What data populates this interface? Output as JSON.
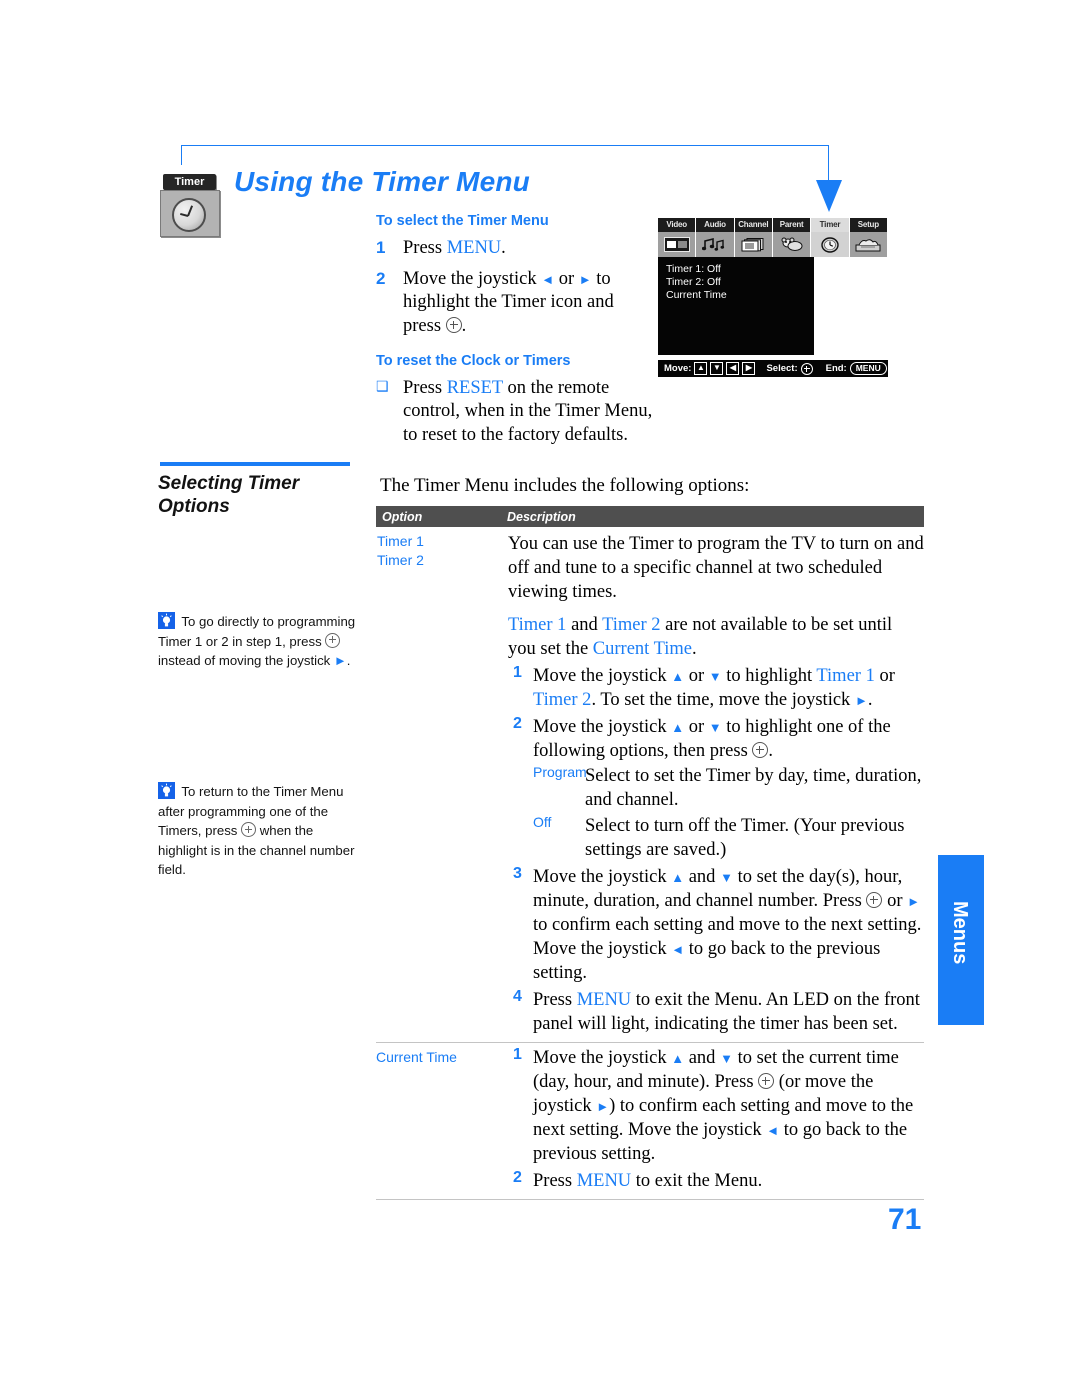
{
  "page": {
    "number": "71",
    "side_tab": "Menus"
  },
  "header": {
    "icon_label": "Timer",
    "icon_name": "clock-icon",
    "title": "Using the Timer Menu",
    "accent_color": "#1a7df5"
  },
  "instructions": {
    "select_heading": "To select the Timer Menu",
    "steps": [
      {
        "num": "1",
        "text_pre": "Press ",
        "keyword": "MENU",
        "text_post": "."
      },
      {
        "num": "2",
        "text": "Move the joystick ← or → to highlight the Timer icon and press ⊕."
      }
    ],
    "reset_heading": "To reset the Clock or Timers",
    "reset_bullet": "❑",
    "reset_text_pre": "Press ",
    "reset_keyword": "RESET",
    "reset_text_post": " on the remote control, when in the Timer Menu, to reset to the factory defaults."
  },
  "tv_menu": {
    "tabs": [
      "Video",
      "Audio",
      "Channel",
      "Parent",
      "Timer",
      "Setup"
    ],
    "selected_tab": "Timer",
    "screen_lines": [
      "Timer 1: Off",
      "Timer 2: Off",
      "Current Time"
    ],
    "footer": {
      "move_label": "Move:",
      "move_keys": [
        "▲",
        "▼",
        "◀",
        "▶"
      ],
      "select_label": "Select:",
      "end_label": "End:",
      "end_key": "MENU"
    }
  },
  "section": {
    "heading_line1": "Selecting Timer",
    "heading_line2": "Options",
    "intro": "The Timer Menu includes the following options:"
  },
  "tips": [
    {
      "icon": "lightbulb-icon",
      "text": "To go directly to programming Timer 1 or 2 in step 1, press ⊕ instead of moving the joystick →."
    },
    {
      "icon": "lightbulb-icon",
      "text": "To return to the Timer Menu after programming one of the Timers, press ⊕ when the highlight is in the channel number field."
    }
  ],
  "table": {
    "headers": {
      "option": "Option",
      "description": "Description"
    },
    "rows": [
      {
        "options": [
          "Timer 1",
          "Timer 2"
        ],
        "paragraphs": [
          "You can use the Timer to program the TV to turn on and off and tune to a specific channel at two scheduled viewing times."
        ],
        "note": {
          "pre": "",
          "kw1": "Timer 1",
          "mid": " and ",
          "kw2": "Timer 2",
          "post": " are not available to be set until you set the ",
          "kw3": "Current Time",
          "end": "."
        },
        "steps": [
          {
            "num": "1",
            "text": "Move the joystick ▲ or ▼ to highlight Timer 1 or Timer 2. To set the time, move the joystick →."
          },
          {
            "num": "2",
            "text": "Move the joystick ▲ or ▼ to highlight one of the following options, then press ⊕."
          }
        ],
        "sub_options": [
          {
            "label": "Program",
            "text": "Select to set the Timer by day, time, duration, and channel."
          },
          {
            "label": "Off",
            "text": "Select to turn off the Timer. (Your previous settings are saved.)"
          }
        ],
        "steps2": [
          {
            "num": "3",
            "text": "Move the joystick ▲ and ▼ to set the day(s), hour, minute, duration, and channel number. Press ⊕ or → to confirm each setting and move to the next setting. Move the joystick ← to go back to the previous setting."
          },
          {
            "num": "4",
            "text": "Press MENU to exit the Menu. An LED on the front panel will light, indicating the timer has been set."
          }
        ]
      },
      {
        "options": [
          "Current Time"
        ],
        "steps": [
          {
            "num": "1",
            "text": "Move the joystick ▲ and ▼ to set the current time (day, hour, and minute). Press ⊕ (or move the joystick →) to confirm each setting and move to the next setting. Move the joystick ← to go back to the previous setting."
          },
          {
            "num": "2",
            "text": "Press MENU to exit the Menu."
          }
        ]
      }
    ]
  }
}
